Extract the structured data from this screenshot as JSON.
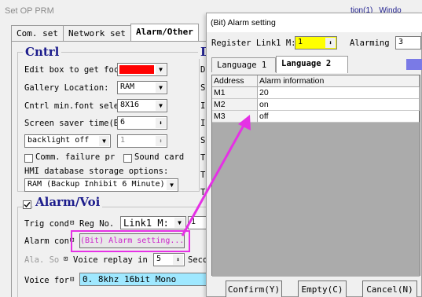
{
  "app": {
    "title": "Set OP PRM",
    "top_links": [
      "tion(1)",
      "Windo"
    ]
  },
  "tabs": [
    "Com. set",
    "Network set",
    "Alarm/Other"
  ],
  "cntrl": {
    "title": "Cntrl",
    "edit_focus_label": "Edit box to get focu",
    "edit_focus_color": "#ff0000",
    "gallery_label": "Gallery Location:",
    "gallery_value": "RAM",
    "font_label": "Cntrl min.font selec",
    "font_value": "8X16",
    "saver_label": "Screen saver time(Br",
    "saver_value": "6",
    "backlight_value": "backlight off",
    "backlight_num": "1",
    "comm_fail_label": "Comm. failure pr",
    "sound_card_label": "Sound card",
    "hmi_db_label": "HMI database storage options:",
    "hmi_db_value": "RAM (Backup Inhibit 6 Minute)"
  },
  "side_labels": [
    "D",
    "De",
    "Sy",
    "In",
    "In",
    "Sc",
    "Te",
    "Te",
    "Te"
  ],
  "alarm_voice": {
    "title": "Alarm/Voi",
    "trig_label": "Trig cond",
    "reg_label": "Reg No.",
    "reg_value": "Link1 M:",
    "reg_num": "1",
    "alarm_label": "Alarm con",
    "alarm_button": "(Bit) Alarm setting...",
    "ala_label": "Ala. So",
    "voice_replay_label": "Voice replay in",
    "voice_replay_value": "5",
    "seco_label": "Seco",
    "voice_format_label": "Voice for",
    "voice_format_value": "0. 8khz  16bit Mono"
  },
  "dialog": {
    "title": "(Bit) Alarm setting",
    "register_label": "Register Link1 M:",
    "register_value": "1",
    "alarming_label": "Alarming",
    "alarming_value": "3",
    "lang_tabs": [
      "Language 1",
      "Language 2"
    ],
    "columns": [
      "Address",
      "Alarm information"
    ],
    "rows": [
      {
        "address": "M1",
        "info": "20"
      },
      {
        "address": "M2",
        "info": "on"
      },
      {
        "address": "M3",
        "info": "off"
      }
    ],
    "buttons": [
      "Confirm(Y)",
      "Empty(C)",
      "Cancel(N)"
    ]
  },
  "colors": {
    "highlight": "#e531e5",
    "group_title": "#1c1c8c",
    "register_field": "#ffff00",
    "voice_field": "#9fe8ff"
  }
}
